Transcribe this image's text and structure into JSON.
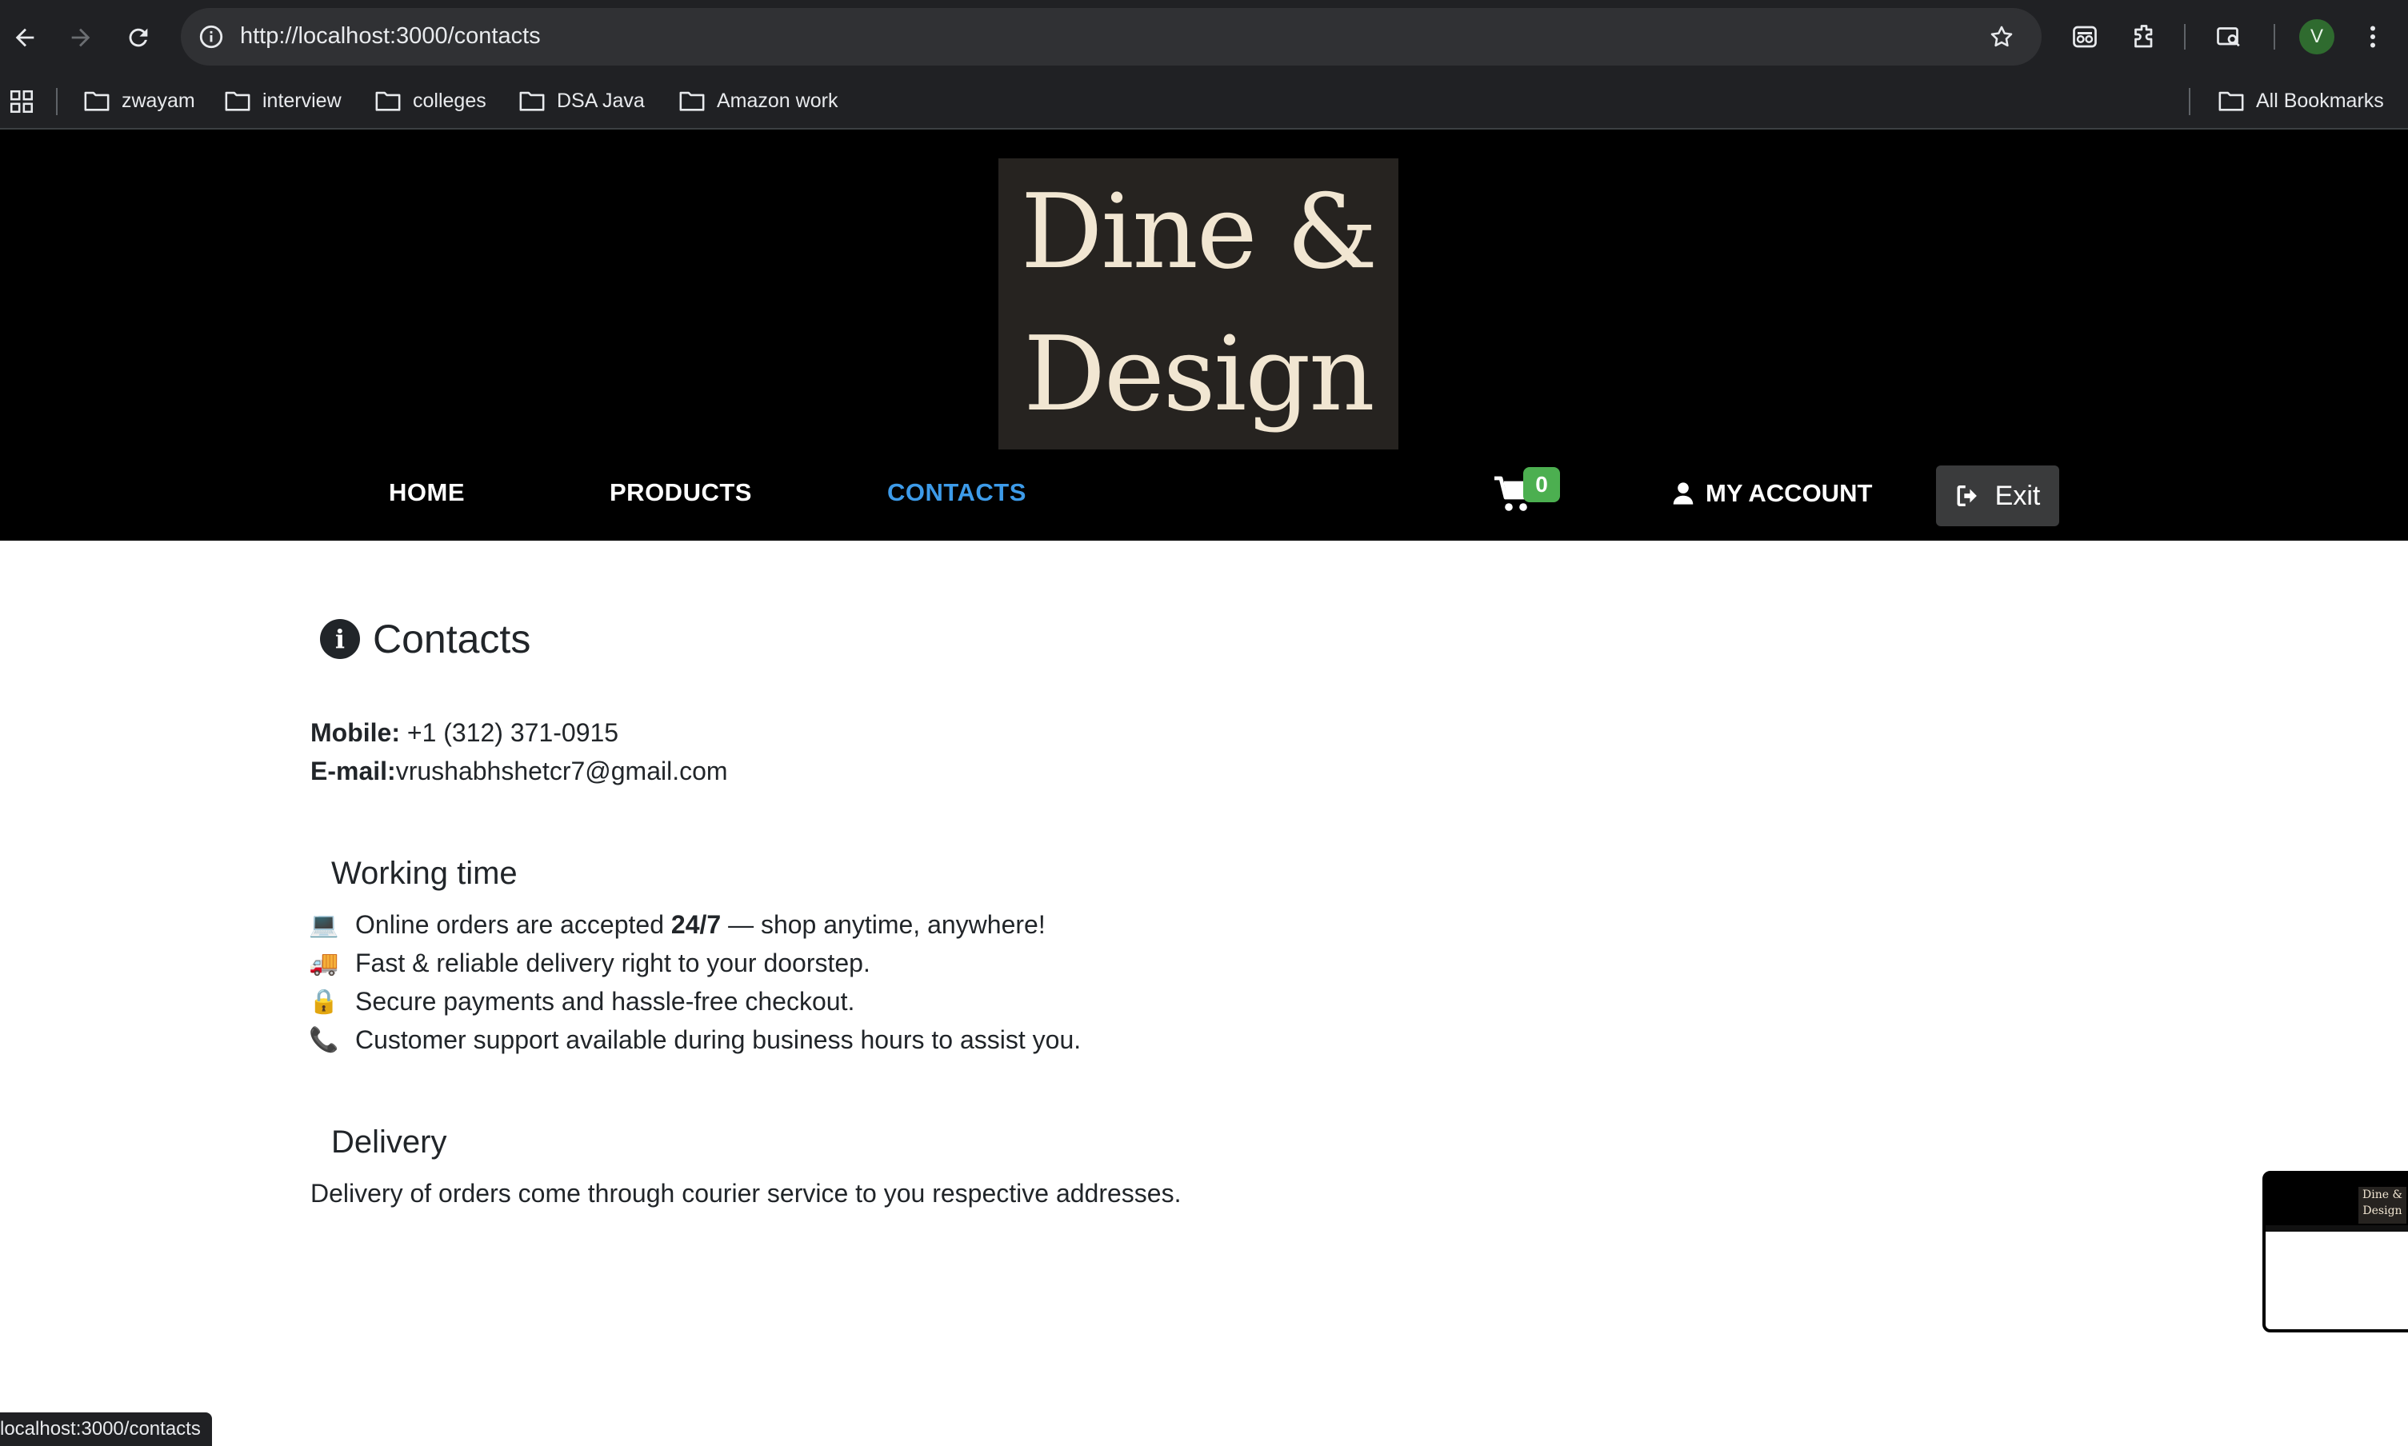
{
  "browser": {
    "url": "http://localhost:3000/contacts",
    "avatar_letter": "V",
    "bookmarks": [
      "zwayam",
      "interview",
      "colleges",
      "DSA Java",
      "Amazon work"
    ],
    "all_bookmarks_label": "All Bookmarks",
    "status_url": "localhost:3000/contacts"
  },
  "site": {
    "logo_line1": "Dine &",
    "logo_line2": "Design",
    "nav": {
      "home": "HOME",
      "products": "PRODUCTS",
      "contacts": "CONTACTS"
    },
    "cart_count": "0",
    "account_label": "MY ACCOUNT",
    "exit_label": "Exit",
    "active_color": "#3d9be9",
    "badge_color": "#4caf50"
  },
  "contacts": {
    "title": "Contacts",
    "mobile_label": "Mobile:",
    "mobile_value": "+1 (312) 371-0915",
    "email_label": "E-mail:",
    "email_value": "vrushabhshetcr7@gmail.com",
    "working_time_heading": "Working time",
    "working_items": [
      {
        "icon": "💻",
        "pre": "Online orders are accepted ",
        "bold": "24/7",
        "post": " — shop anytime, anywhere!"
      },
      {
        "icon": "🚚",
        "text": "Fast & reliable delivery right to your doorstep."
      },
      {
        "icon": "🔒",
        "text": "Secure payments and hassle-free checkout."
      },
      {
        "icon": "📞",
        "text": "Customer support available during business hours to assist you."
      }
    ],
    "delivery_heading": "Delivery",
    "delivery_text": "Delivery of orders come through courier service to you respective addresses."
  },
  "thumbnail": {
    "logo_line1": "Dine &",
    "logo_line2": "Design"
  }
}
